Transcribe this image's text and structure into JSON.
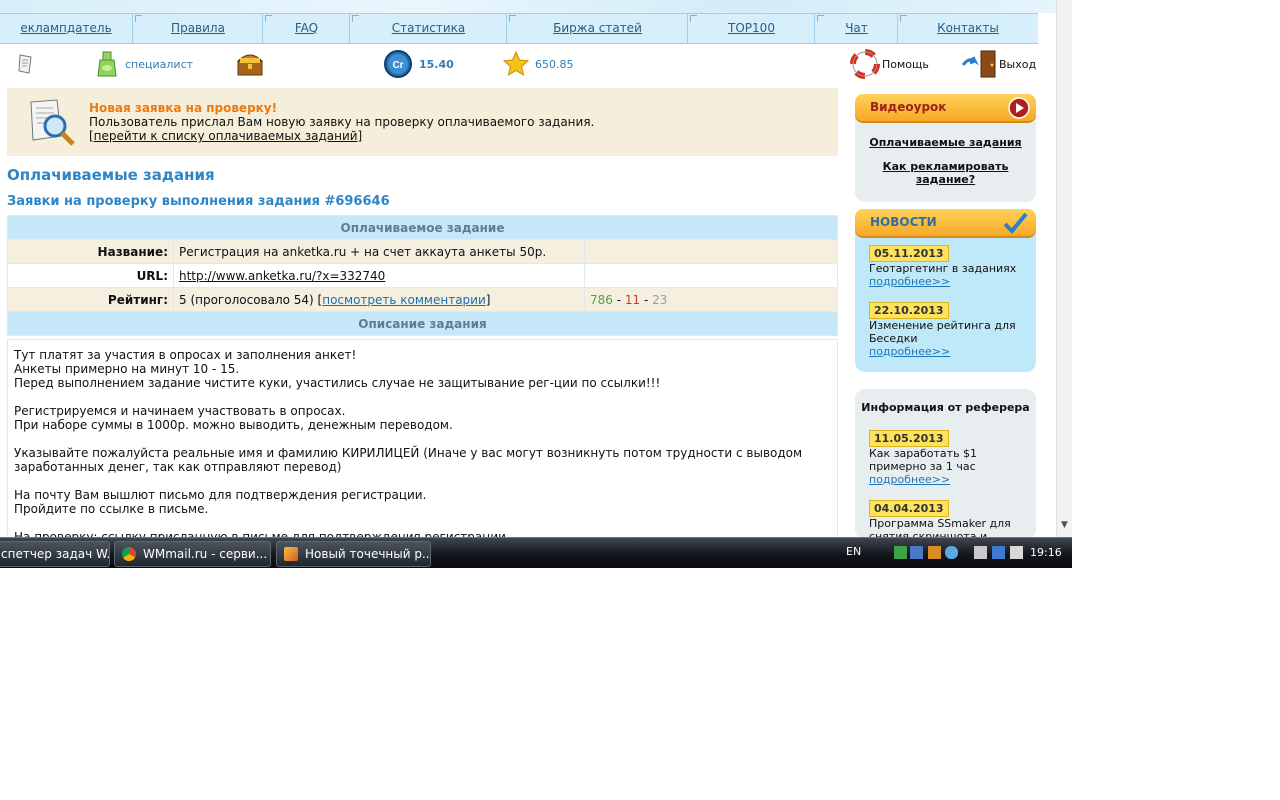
{
  "nav": {
    "items": [
      "еклампдатель",
      "Правила",
      "FAQ",
      "Статистика",
      "Биржа статей",
      "TOP100",
      "Чат",
      "Контакты"
    ]
  },
  "userbar": {
    "status": "специалист",
    "credit_badge": "Cr",
    "credits": "15.40",
    "rating": "650.85",
    "help": "Помощь",
    "exit": "Выход"
  },
  "notice": {
    "title": "Новая заявка на проверку!",
    "message": "Пользователь прислал Вам новую заявку на проверку оплачиваемого задания.",
    "link": "[перейти к списку оплачиваемых заданий]"
  },
  "page": {
    "title": "Оплачиваемые задания",
    "subtitle": "Заявки на проверку выполнения задания #696646"
  },
  "task": {
    "header": "Оплачиваемое задание",
    "name_label": "Название:",
    "name": "Регистрация на anketka.ru + на счет аккаута анкеты 50р.",
    "url_label": "URL:",
    "url": "http://www.anketka.ru/?x=332740",
    "rating_label": "Рейтинг:",
    "rating_text": "5 (проголосовало 54) [",
    "comments_link": "посмотреть комментарии",
    "rating_close": "]",
    "votes_plus": "786",
    "votes_minus": "11",
    "votes_neutral": "23",
    "votes_sep": " - ",
    "desc_header": "Описание задания",
    "description": "Тут платят за участия в опросах и заполнения анкет!\nАнкеты примерно на минут 10 - 15.\nПеред выполнением задание чистите куки, участились случае не защитывание рег-ции по ссылки!!!\n\nРегистрируемся и начинаем участвовать в опросах.\nПри наборе суммы в 1000р. можно выводить, денежным переводом.\n\nУказывайте пожалуйста реальные имя и фамилию КИРИЛИЦЕЙ (Иначе у вас могут возникнуть потом трудности с выводом заработанных денег, так как отправляют перевод)\n\nНа почту Вам вышлют письмо для подтверждения регистрации.\nПройдите по ссылке в письме.\n\nНа проверку: ссылку присланную в письме для подтверждения регистрации."
  },
  "video": {
    "title": "Видеоурок",
    "link1": "Оплачиваемые задания",
    "link2": "Как рекламировать задание?"
  },
  "news": {
    "title": "НОВОСТИ",
    "items": [
      {
        "date": "05.11.2013",
        "text": "Геотаргетинг в заданиях",
        "more": "подробнее>>"
      },
      {
        "date": "22.10.2013",
        "text": "Изменение рейтинга для Беседки",
        "more": "подробнее>>"
      }
    ]
  },
  "referrer": {
    "title": "Информация от реферера",
    "items": [
      {
        "date": "11.05.2013",
        "text": "Как заработать $1 примерно за 1 час",
        "more": "подробнее>>"
      },
      {
        "date": "04.04.2013",
        "text": "Программа SSmaker для снятия скриншота и",
        "more": ""
      }
    ]
  },
  "taskbar": {
    "windows": [
      "спетчер задач W...",
      "WMmail.ru - серви...",
      "Новый точечный р..."
    ],
    "lang": "EN",
    "clock": "19:16"
  },
  "colors": {
    "accent": "#2f86c6",
    "notice_bg": "#f5eedb",
    "news_bg": "#bfe8f9",
    "orange_header": "#f6a826"
  }
}
